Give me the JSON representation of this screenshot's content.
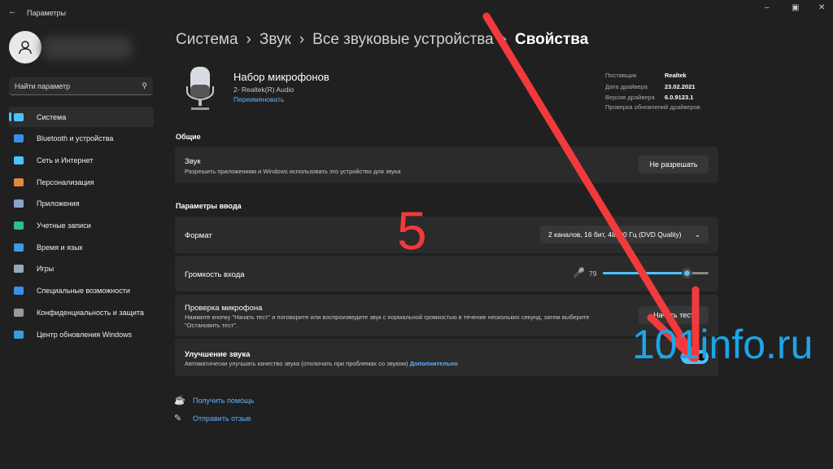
{
  "window": {
    "title": "Параметры"
  },
  "search": {
    "placeholder": "Найти параметр"
  },
  "sidebar": {
    "items": [
      {
        "label": "Система",
        "color": "#4cc2ff"
      },
      {
        "label": "Bluetooth и устройства",
        "color": "#3b8eea"
      },
      {
        "label": "Сеть и Интернет",
        "color": "#4cc2ff"
      },
      {
        "label": "Персонализация",
        "color": "#e08a3c"
      },
      {
        "label": "Приложения",
        "color": "#8aa4c8"
      },
      {
        "label": "Учетные записи",
        "color": "#2fbf8f"
      },
      {
        "label": "Время и язык",
        "color": "#3b9be0"
      },
      {
        "label": "Игры",
        "color": "#9aa7b8"
      },
      {
        "label": "Специальные возможности",
        "color": "#3b8eea"
      },
      {
        "label": "Конфиденциальность и защита",
        "color": "#9a9a9a"
      },
      {
        "label": "Центр обновления Windows",
        "color": "#3b9be0"
      }
    ]
  },
  "breadcrumb": [
    "Система",
    "Звук",
    "Все звуковые устройства",
    "Свойства"
  ],
  "device": {
    "name": "Набор микрофонов",
    "sub": "2- Realtek(R) Audio",
    "rename": "Переименовать"
  },
  "driver": {
    "vendor_label": "Поставщик",
    "vendor": "Realtek",
    "date_label": "Дата драйвера",
    "date": "23.02.2021",
    "version_label": "Версия драйвера",
    "version": "6.0.9123.1",
    "update_link": "Проверка обновлений драйверов"
  },
  "general": {
    "heading": "Общие",
    "sound_title": "Звук",
    "sound_desc": "Разрешить приложениям и Windows использовать это устройство для звука",
    "sound_button": "Не разрешать"
  },
  "input": {
    "heading": "Параметры ввода",
    "format_label": "Формат",
    "format_value": "2 каналов, 16 бит, 48000 Гц (DVD Quality)",
    "volume_label": "Громкость входа",
    "volume": 79,
    "test_title": "Проверка микрофона",
    "test_desc": "Нажмите кнопку \"Начать тест\" и поговорите или воспроизведите звук с нормальной громкостью в течение нескольких секунд, затем выберите \"Остановить тест\".",
    "test_button": "Начать тест",
    "enh_title": "Улучшение звука",
    "enh_desc": "Автоматически улучшать качество звука (отключать при проблемах со звуком)",
    "enh_link": "Дополнительно",
    "enh_state": "Вкл."
  },
  "footer": {
    "help": "Получить помощь",
    "feedback": "Отправить отзыв"
  },
  "overlay": {
    "step": "5",
    "watermark": "101info.ru"
  }
}
